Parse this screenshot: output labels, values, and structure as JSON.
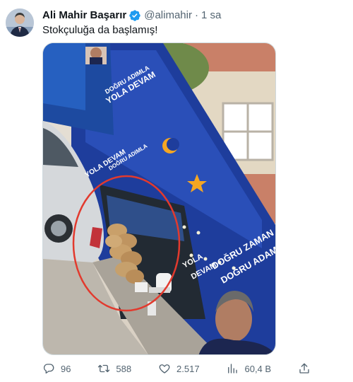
{
  "tweet": {
    "author_name": "Ali Mahir Başarır",
    "handle": "@alimahir",
    "separator": "·",
    "time": "1 sa",
    "text": "Stokçuluğa da başlamış!",
    "verified": true
  },
  "media_signs": {
    "left_banner_1": "DOĞRU ADIMLA",
    "left_banner_2": "YOLA DEVAM",
    "left_banner_3": "DOĞRU ADIMLA",
    "left_banner_4": "YOLA DEVAM",
    "bottom_line_1": "DOĞRU ZAMAN",
    "bottom_line_2": "DOĞRU ADAM",
    "bottom_side_1": "YOLA",
    "bottom_side_2": "DEVAM"
  },
  "actions": {
    "replies": "96",
    "reposts": "588",
    "likes": "2.517",
    "views": "60,4 B"
  },
  "colors": {
    "text_primary": "#0f1419",
    "text_secondary": "#536471",
    "verified_blue": "#1d9bf0",
    "banner_blue": "#1e3d9c",
    "circle_red": "#e23a2e"
  },
  "icons": {
    "reply": "reply-icon",
    "repost": "repost-icon",
    "like": "like-icon",
    "views": "views-icon",
    "share": "share-icon",
    "verified": "verified-icon"
  }
}
